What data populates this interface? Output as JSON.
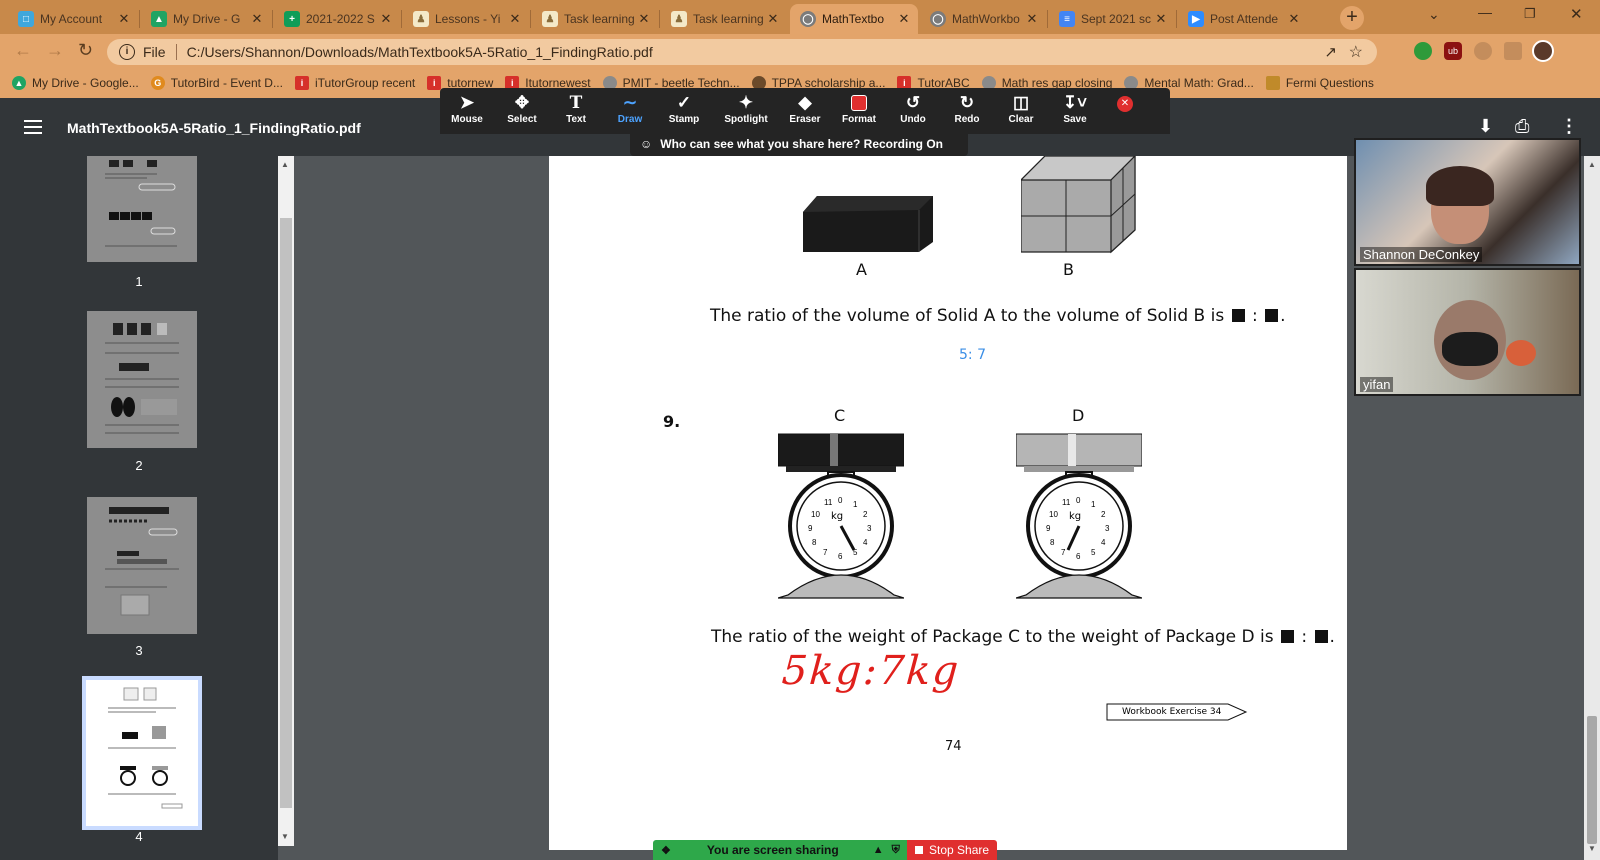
{
  "browser": {
    "tabs": [
      {
        "title": "My Account",
        "favicon": "account-icon",
        "color": "#3fa7dc"
      },
      {
        "title": "My Drive - G",
        "favicon": "drive-icon",
        "color": "#1fa463"
      },
      {
        "title": "2021-2022 S",
        "favicon": "sheets-icon",
        "color": "#0f9d58"
      },
      {
        "title": "Lessons - Yi",
        "favicon": "tutor-icon",
        "color": "#8a6d3b"
      },
      {
        "title": "Task learning",
        "favicon": "tutor-icon",
        "color": "#8a6d3b"
      },
      {
        "title": "Task learning",
        "favicon": "tutor-icon",
        "color": "#8a6d3b"
      },
      {
        "title": "MathTextbo",
        "favicon": "globe-icon",
        "color": "#7b7b7b",
        "active": true
      },
      {
        "title": "MathWorkbo",
        "favicon": "globe-icon",
        "color": "#7b7b7b"
      },
      {
        "title": "Sept 2021 sc",
        "favicon": "docs-icon",
        "color": "#4285f4"
      },
      {
        "title": "Post Attende",
        "favicon": "zoom-icon",
        "color": "#2d8cff"
      }
    ],
    "url_prefix": "File",
    "url": "C:/Users/Shannon/Downloads/MathTextbook5A-5Ratio_1_FindingRatio.pdf",
    "bookmarks": [
      {
        "label": "My Drive - Google...",
        "icon": "drive-icon",
        "color": "#1fa463"
      },
      {
        "label": "TutorBird - Event D...",
        "icon": "tutorbird-icon",
        "color": "#e08a1e"
      },
      {
        "label": "iTutorGroup recent",
        "icon": "itutor-icon",
        "color": "#d6302a"
      },
      {
        "label": "tutornew",
        "icon": "itutor-icon",
        "color": "#d6302a"
      },
      {
        "label": "Itutornewest",
        "icon": "itutor-icon",
        "color": "#d6302a"
      },
      {
        "label": "PMIT - beetle Techn...",
        "icon": "globe-icon",
        "color": "#8a8a8a"
      },
      {
        "label": "TPPA scholarship a...",
        "icon": "tppa-icon",
        "color": "#6b4a2a"
      },
      {
        "label": "TutorABC",
        "icon": "itutor-icon",
        "color": "#d6302a"
      },
      {
        "label": "Math res gap closing",
        "icon": "globe-icon",
        "color": "#8a8a8a"
      },
      {
        "label": "Mental Math: Grad...",
        "icon": "globe-icon",
        "color": "#8a8a8a"
      },
      {
        "label": "Fermi Questions",
        "icon": "fermi-icon",
        "color": "#c08a2a"
      }
    ]
  },
  "pdf": {
    "filename": "MathTextbook5A-5Ratio_1_FindingRatio.pdf",
    "pages": [
      "1",
      "2",
      "3",
      "4"
    ],
    "current_page": "4"
  },
  "annotation_toolbar": {
    "tools": [
      {
        "label": "Mouse",
        "icon": "cursor-icon"
      },
      {
        "label": "Select",
        "icon": "move-icon"
      },
      {
        "label": "Text",
        "icon": "text-icon"
      },
      {
        "label": "Draw",
        "icon": "draw-icon",
        "active": true
      },
      {
        "label": "Stamp",
        "icon": "checkmark-icon"
      },
      {
        "label": "Spotlight",
        "icon": "spotlight-icon"
      },
      {
        "label": "Eraser",
        "icon": "eraser-icon"
      },
      {
        "label": "Format",
        "icon": "format-icon"
      },
      {
        "label": "Undo",
        "icon": "undo-icon"
      },
      {
        "label": "Redo",
        "icon": "redo-icon"
      },
      {
        "label": "Clear",
        "icon": "trash-icon"
      },
      {
        "label": "Save",
        "icon": "save-icon"
      }
    ],
    "recording_text": "Who can see what you share here? Recording On"
  },
  "document": {
    "solid_labels": [
      "A",
      "B"
    ],
    "q8_text": "The ratio of the volume of Solid A to the volume of Solid B is",
    "q8_answer": "5: 7",
    "q9_number": "9.",
    "package_labels": [
      "C",
      "D"
    ],
    "scale_unit": "kg",
    "dial_numbers": [
      "11",
      "0",
      "1",
      "2",
      "3",
      "4",
      "5",
      "6",
      "7",
      "8",
      "9",
      "10"
    ],
    "q9_text": "The ratio of the weight of Package C to the weight of Package D is",
    "q9_handwritten": "5kg:7kg",
    "workbook_ref": "Workbook Exercise 34",
    "page_number": "74"
  },
  "video": [
    {
      "name": "Shannon DeConkey"
    },
    {
      "name": "yifan"
    }
  ],
  "sharebar": {
    "status": "You are screen sharing",
    "stop_label": "Stop Share"
  },
  "colors": {
    "browser_frame": "#e3a46a",
    "answer_blue": "#3a8ee6",
    "handwriting_red": "#e0201c",
    "share_green": "#2ea84a",
    "stop_red": "#e02f2f"
  }
}
